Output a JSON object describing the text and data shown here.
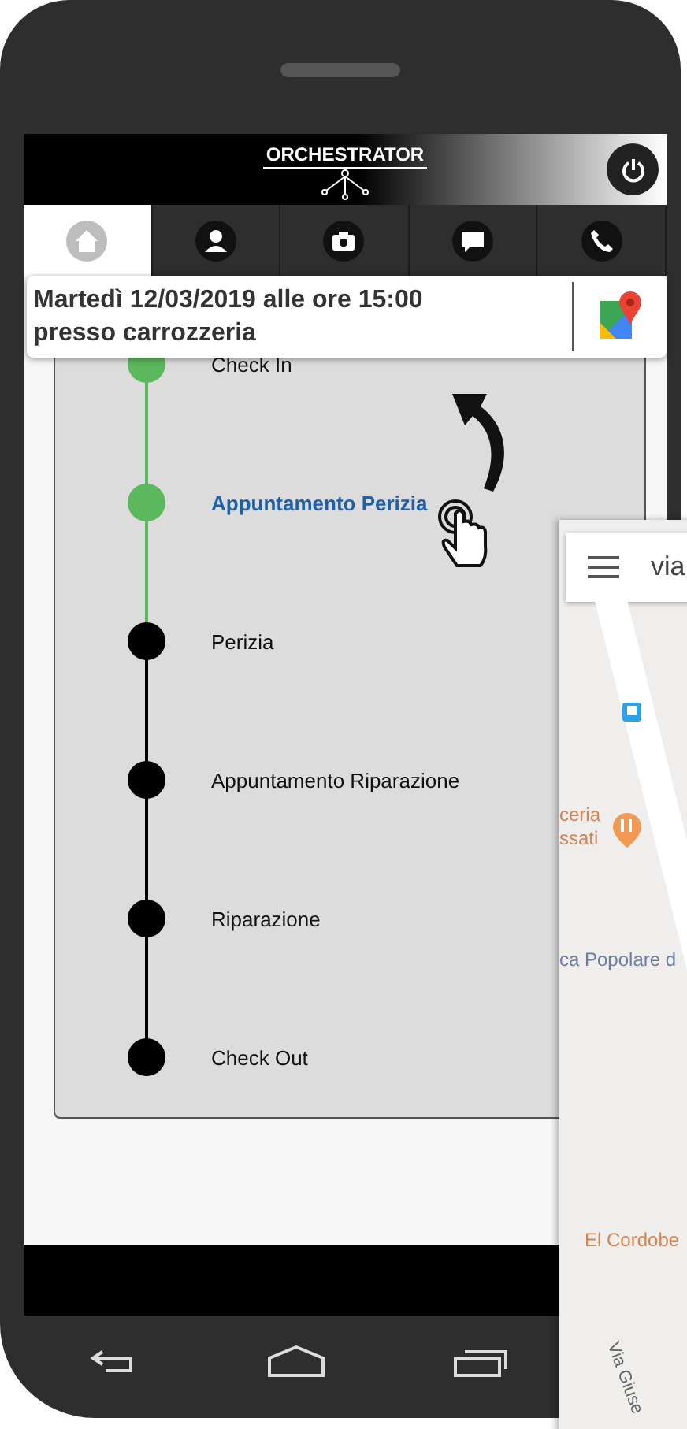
{
  "header": {
    "logo": "ORCHESTRATOR"
  },
  "tabs": [
    {
      "kind": "home",
      "selected": true
    },
    {
      "kind": "person",
      "selected": false
    },
    {
      "kind": "camera",
      "selected": false
    },
    {
      "kind": "chat",
      "selected": false
    },
    {
      "kind": "phone",
      "selected": false
    }
  ],
  "appointment": {
    "text": "Martedì 12/03/2019 alle ore 15:00 presso carrozzeria"
  },
  "steps": [
    {
      "label": "Check In",
      "done": true,
      "selected": false
    },
    {
      "label": "Appuntamento Perizia",
      "done": true,
      "selected": true
    },
    {
      "label": "Perizia",
      "done": false,
      "selected": false
    },
    {
      "label": "Appuntamento Riparazione",
      "done": false,
      "selected": false
    },
    {
      "label": "Riparazione",
      "done": false,
      "selected": false
    },
    {
      "label": "Check Out",
      "done": false,
      "selected": false
    }
  ],
  "map": {
    "search_value": "via",
    "labels": [
      {
        "kind": "poi",
        "text": "ceria\nssati"
      },
      {
        "kind": "place",
        "text": "ca Popolare d"
      },
      {
        "kind": "poi",
        "text": "El Cordobe"
      },
      {
        "kind": "street",
        "text": "Via Giuse"
      }
    ]
  }
}
